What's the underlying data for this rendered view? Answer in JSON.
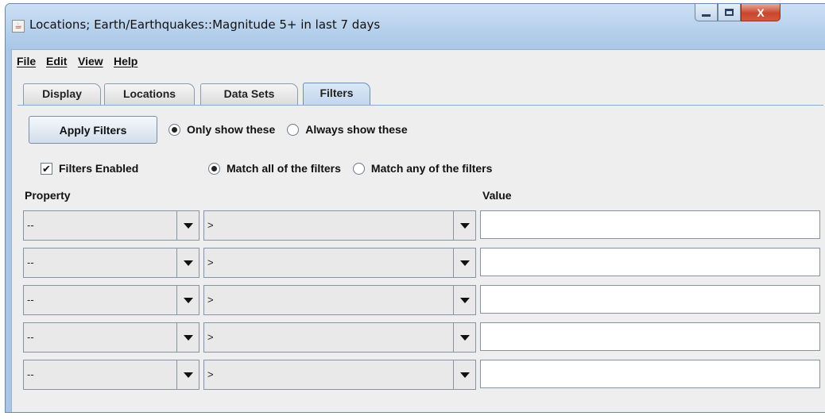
{
  "window": {
    "icon": "java-cup-icon",
    "title": "Locations; Earth/Earthquakes::Magnitude 5+ in last 7 days",
    "controls": {
      "minimize": "minimize",
      "maximize": "maximize",
      "close": "X"
    }
  },
  "menubar": [
    {
      "label": "File"
    },
    {
      "label": "Edit"
    },
    {
      "label": "View"
    },
    {
      "label": "Help"
    }
  ],
  "tabs": [
    {
      "label": "Display"
    },
    {
      "label": "Locations"
    },
    {
      "label": "Data Sets"
    },
    {
      "label": "Filters",
      "active": true
    }
  ],
  "filters": {
    "apply_label": "Apply Filters",
    "show_mode": {
      "options": [
        "Only show these",
        "Always show these"
      ],
      "selected": "Only show these"
    },
    "enabled_label": "Filters Enabled",
    "enabled_checked": true,
    "checkmark": "✔",
    "match_mode": {
      "options": [
        "Match all of the filters",
        "Match any of the filters"
      ],
      "selected": "Match all of the filters"
    },
    "columns": {
      "property": "Property",
      "value": "Value"
    },
    "rows": [
      {
        "property": "--",
        "operator": ">",
        "value": ""
      },
      {
        "property": "--",
        "operator": ">",
        "value": ""
      },
      {
        "property": "--",
        "operator": ">",
        "value": ""
      },
      {
        "property": "--",
        "operator": ">",
        "value": ""
      },
      {
        "property": "--",
        "operator": ">",
        "value": ""
      }
    ]
  },
  "colors": {
    "titlebar": "#b6d0ec",
    "panel": "#eeeeee",
    "active_tab": "#c3d6ee",
    "close_button": "#c8462e"
  }
}
